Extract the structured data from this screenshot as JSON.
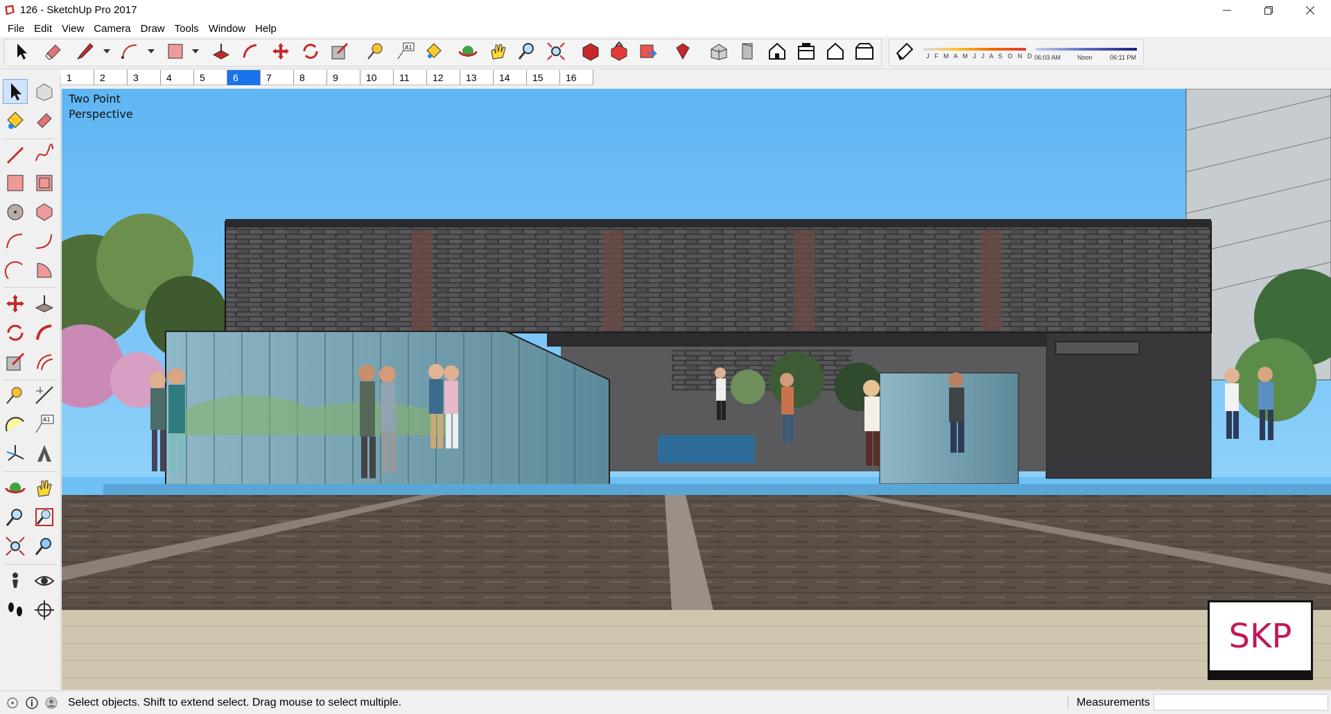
{
  "window": {
    "title": "126 - SketchUp Pro 2017",
    "controls": [
      "minimize",
      "restore",
      "close"
    ]
  },
  "menu": [
    "File",
    "Edit",
    "View",
    "Camera",
    "Draw",
    "Tools",
    "Window",
    "Help"
  ],
  "shadow_panel": {
    "months": "J F M A M J J A S O N D",
    "time_start": "06:03 AM",
    "time_mid": "Noon",
    "time_end": "06:11 PM"
  },
  "scenes": {
    "tabs": [
      "1",
      "2",
      "3",
      "4",
      "5",
      "6",
      "7",
      "8",
      "9",
      "10",
      "11",
      "12",
      "13",
      "14",
      "15",
      "16"
    ],
    "active": "6"
  },
  "viewport": {
    "camera_label": "Two Point\nPerspective",
    "watermark": "SKP"
  },
  "status": {
    "message": "Select objects. Shift to extend select. Drag mouse to select multiple.",
    "measurements_label": "Measurements",
    "measurements_value": ""
  },
  "colors": {
    "sky": "#6ec0f5",
    "active_tab": "#1a73e8",
    "brick": "#3b3b3d",
    "pavement": "#5a5048",
    "watermark": "#c2185b"
  }
}
